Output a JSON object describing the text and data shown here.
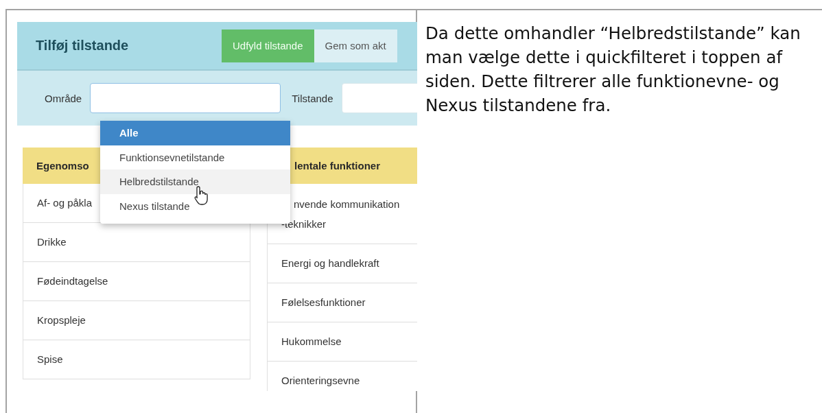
{
  "screenshot": {
    "title": "Tilføj tilstande",
    "buttons": [
      {
        "label": "Udfyld tilstande",
        "kind": "primary"
      },
      {
        "label": "Gem som akt",
        "kind": "secondary"
      }
    ],
    "filters": [
      {
        "label": "Område",
        "expanded": true
      },
      {
        "label": "Tilstande",
        "expanded": false
      }
    ],
    "dropdown": {
      "options": [
        {
          "label": "Alle",
          "selected": true,
          "hovered": false
        },
        {
          "label": "Funktionsevnetilstande",
          "selected": false,
          "hovered": false
        },
        {
          "label": "Helbredstilstande",
          "selected": false,
          "hovered": true
        },
        {
          "label": "Nexus tilstande",
          "selected": false,
          "hovered": false
        }
      ]
    },
    "columns": [
      {
        "heading": "Egenomso",
        "rows": [
          [
            "Af- og påkla"
          ],
          [
            "Drikke"
          ],
          [
            "Fødeindtagelse"
          ],
          [
            "Kropspleje"
          ],
          [
            "Spise"
          ]
        ]
      },
      {
        "heading": "lentale funktioner",
        "rows": [
          [
            "nvende kommunikation",
            "-teknikker"
          ],
          [
            "Energi og handlekraft"
          ],
          [
            "Følelsesfunktioner"
          ],
          [
            "Hukommelse"
          ],
          [
            "Orienteringsevne"
          ]
        ]
      }
    ]
  },
  "description": "Da dette omhandler “Helbredstilstande” kan man vælge dette i quickfilteret i toppen af siden. Dette filtrerer alle funktionevne- og Nexus tilstandene fra."
}
